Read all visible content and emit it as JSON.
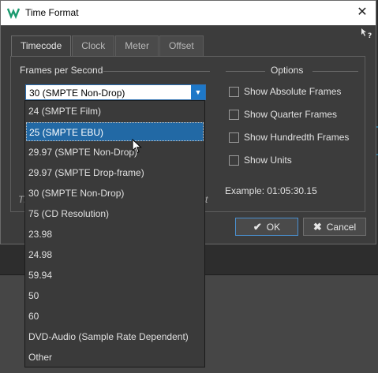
{
  "window": {
    "title": "Time Format",
    "close_glyph": "✕",
    "help_glyph": "?"
  },
  "tabs": [
    {
      "label": "Timecode",
      "active": true
    },
    {
      "label": "Clock",
      "active": false
    },
    {
      "label": "Meter",
      "active": false
    },
    {
      "label": "Offset",
      "active": false
    }
  ],
  "frames": {
    "heading": "Frames per Second",
    "selected": "30 (SMPTE Non-Drop)",
    "options": [
      "24 (SMPTE Film)",
      "25 (SMPTE EBU)",
      "29.97 (SMPTE Non-Drop)",
      "29.97 (SMPTE Drop-frame)",
      "30 (SMPTE Non-Drop)",
      "75 (CD Resolution)",
      "23.98",
      "24.98",
      "59.94",
      "50",
      "60",
      "DVD-Audio (Sample Rate Dependent)",
      "Other"
    ],
    "highlighted": "25 (SMPTE EBU)"
  },
  "options": {
    "heading": "Options",
    "checkboxes": [
      {
        "label": "Show Absolute Frames",
        "checked": false
      },
      {
        "label": "Show Quarter Frames",
        "checked": false
      },
      {
        "label": "Show Hundredth Frames",
        "checked": false
      },
      {
        "label": "Show Units",
        "checked": false
      }
    ],
    "example": "Example: 01:05:30.15"
  },
  "partial_text": {
    "left": "Th",
    "right": "t"
  },
  "buttons": {
    "ok": "OK",
    "cancel": "Cancel"
  },
  "icons": {
    "app": "wavelab-icon",
    "help": "context-help-icon",
    "ok": "check-icon",
    "cancel": "x-icon",
    "dropdown": "triangle-down-icon",
    "cursor": "mouse-pointer-icon"
  },
  "colors": {
    "highlight": "#2269a5",
    "accent": "#1e78c8",
    "dialog_bg": "#3c3c3c"
  }
}
